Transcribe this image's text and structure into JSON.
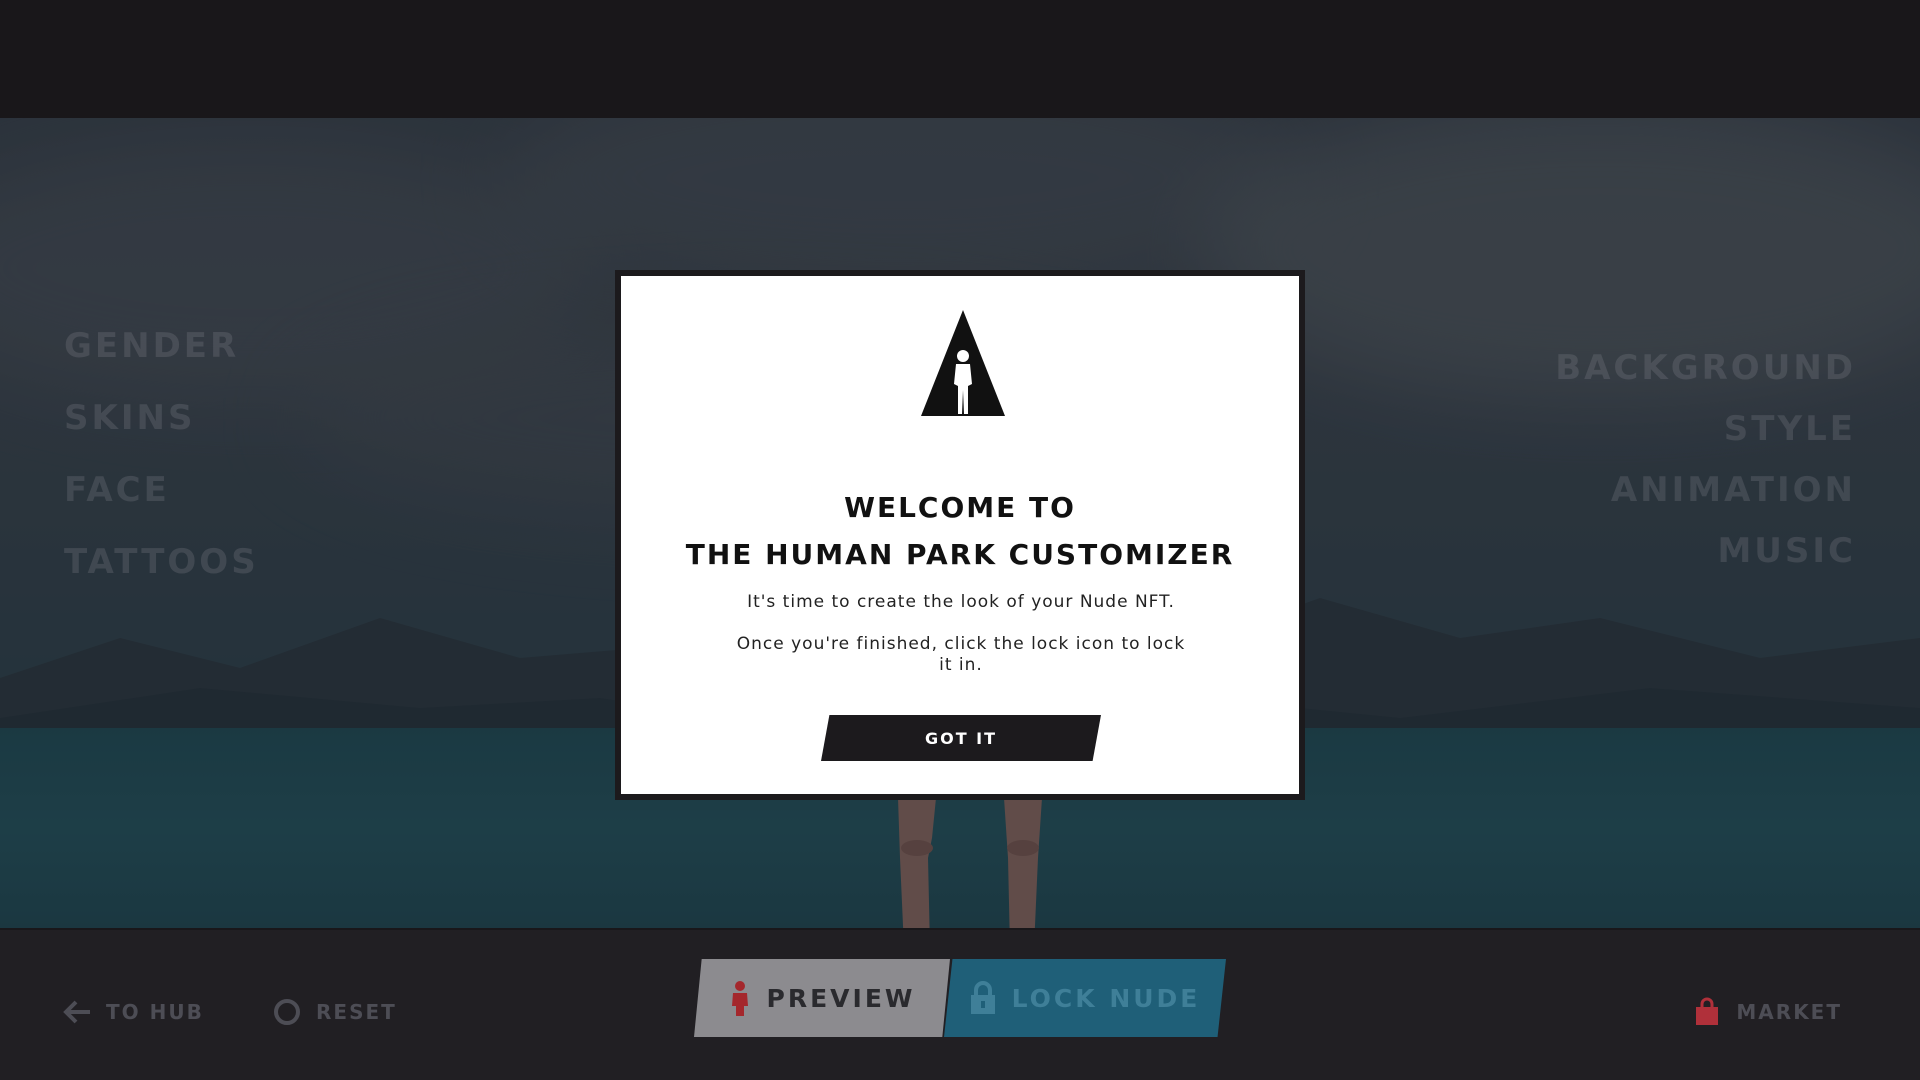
{
  "left_menu": {
    "items": [
      {
        "label": "GENDER"
      },
      {
        "label": "SKINS"
      },
      {
        "label": "FACE"
      },
      {
        "label": "TATTOOS"
      }
    ]
  },
  "right_menu": {
    "items": [
      {
        "label": "BACKGROUND"
      },
      {
        "label": "STYLE"
      },
      {
        "label": "ANIMATION"
      },
      {
        "label": "MUSIC"
      }
    ]
  },
  "modal": {
    "logo_icon": "triangle-figure-logo-icon",
    "title_line1": "WELCOME TO",
    "title_line2": "THE HUMAN PARK CUSTOMIZER",
    "text1": "It's time to create the look of your Nude NFT.",
    "text2": "Once you're finished, click the lock icon to lock it in.",
    "button_label": "GOT IT"
  },
  "bottom_bar": {
    "to_hub_label": "TO HUB",
    "reset_label": "RESET",
    "preview_label": "PREVIEW",
    "lock_label": "LOCK NUDE",
    "market_label": "MARKET"
  },
  "colors": {
    "dark": "#1c1a1d",
    "preview_bg": "#8c8b8f",
    "lock_bg": "#1f5f78",
    "market_icon": "#b0303a",
    "preview_figure": "#a4272c"
  }
}
